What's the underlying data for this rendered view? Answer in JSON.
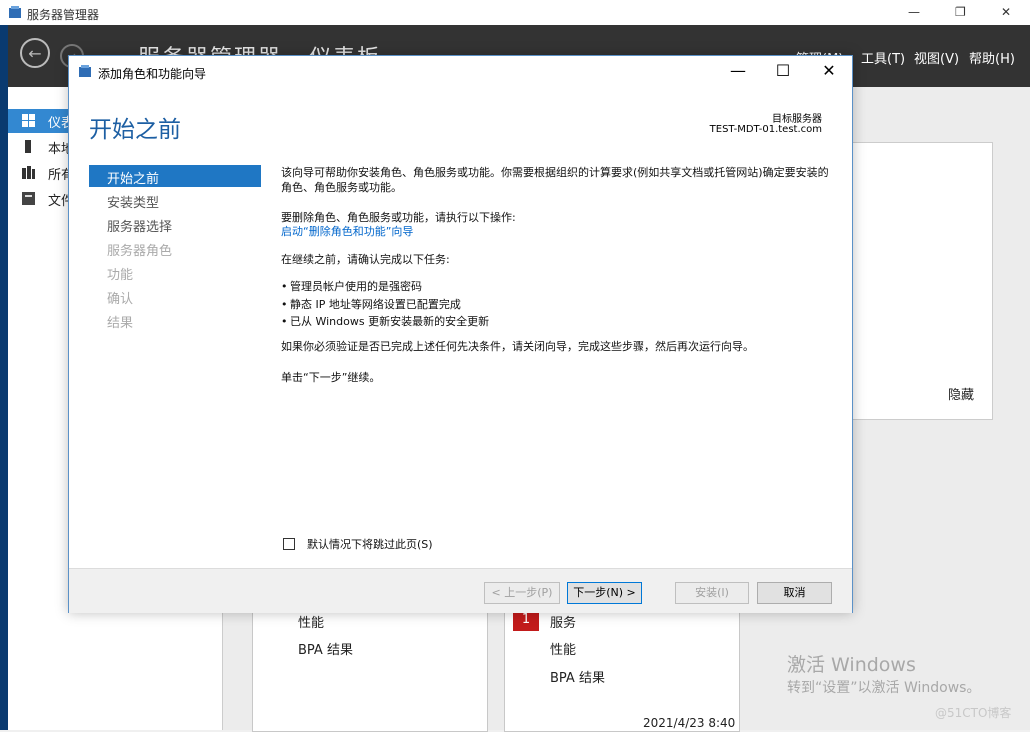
{
  "server_manager": {
    "title": "服务器管理器",
    "breadcrumb": "服务器管理器 · 仪表板",
    "menus": [
      "管理(M)",
      "工具(T)",
      "视图(V)",
      "帮助(H)"
    ],
    "window_controls": [
      "—",
      "❐",
      "✕"
    ],
    "nav": [
      {
        "label": "仪表板",
        "icon": "dashboard-icon"
      },
      {
        "label": "本地服务器",
        "icon": "local-server-icon"
      },
      {
        "label": "所有服务器",
        "icon": "all-servers-icon"
      },
      {
        "label": "文件和存储服务",
        "icon": "file-storage-icon"
      }
    ],
    "hide_link": "隐藏",
    "tile_left": {
      "lines": [
        "性能",
        "BPA 结果"
      ]
    },
    "tile_right": {
      "badge": "1",
      "lines": [
        "服务",
        "性能",
        "BPA 结果"
      ]
    },
    "timestamp": "2021/4/23 8:40",
    "activation": {
      "line1": "激活 Windows",
      "line2": "转到“设置”以激活 Windows。"
    },
    "watermark": "@51CTO博客"
  },
  "dialog": {
    "title": "添加角色和功能向导",
    "controls": {
      "minimize": "—",
      "maximize": "☐",
      "close": "✕"
    },
    "page_title": "开始之前",
    "target_label": "目标服务器",
    "target_value": "TEST-MDT-01.test.com",
    "steps": [
      {
        "label": "开始之前",
        "state": "active"
      },
      {
        "label": "安装类型",
        "state": "enabled"
      },
      {
        "label": "服务器选择",
        "state": "enabled"
      },
      {
        "label": "服务器角色",
        "state": "disabled"
      },
      {
        "label": "功能",
        "state": "disabled"
      },
      {
        "label": "确认",
        "state": "disabled"
      },
      {
        "label": "结果",
        "state": "disabled"
      }
    ],
    "intro": "该向导可帮助你安装角色、角色服务或功能。你需要根据组织的计算要求(例如共享文档或托管网站)确定要安装的角色、角色服务或功能。",
    "remove_text": "要删除角色、角色服务或功能，请执行以下操作:",
    "remove_link": "启动“删除角色和功能”向导",
    "before_text": "在继续之前，请确认完成以下任务:",
    "bullets": [
      "管理员帐户使用的是强密码",
      "静态 IP 地址等网络设置已配置完成",
      "已从 Windows 更新安装最新的安全更新"
    ],
    "verify_text": "如果你必须验证是否已完成上述任何先决条件，请关闭向导，完成这些步骤，然后再次运行向导。",
    "next_hint": "单击“下一步”继续。",
    "skip_label": "默认情况下将跳过此页(S)",
    "skip_checked": false,
    "buttons": {
      "prev": "< 上一步(P)",
      "next": "下一步(N) >",
      "install": "安装(I)",
      "cancel": "取消"
    }
  }
}
